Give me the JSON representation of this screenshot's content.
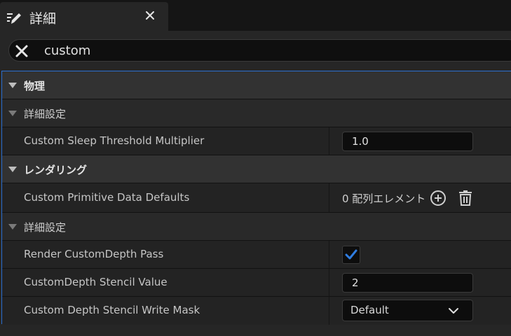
{
  "tab": {
    "title": "詳細",
    "icon": "details-pencil-icon",
    "close_icon": "close-icon"
  },
  "search": {
    "value": "custom",
    "clear_icon": "clear-search-icon"
  },
  "sections": {
    "physics": {
      "label": "物理"
    },
    "physics_advanced": {
      "label": "詳細設定"
    },
    "rendering": {
      "label": "レンダリング"
    },
    "rendering_advanced": {
      "label": "詳細設定"
    }
  },
  "props": {
    "sleep_threshold": {
      "label": "Custom Sleep Threshold Multiplier",
      "value": "1.0"
    },
    "primitive_data": {
      "label": "Custom Primitive Data Defaults",
      "value": "0 配列エレメント"
    },
    "custom_depth_pass": {
      "label": "Render CustomDepth Pass",
      "checked": true
    },
    "stencil_value": {
      "label": "CustomDepth Stencil Value",
      "value": "2"
    },
    "stencil_mask": {
      "label": "Custom Depth Stencil Write Mask",
      "value": "Default"
    }
  },
  "colors": {
    "accent": "#2b6fd1",
    "check": "#2f7de1"
  }
}
